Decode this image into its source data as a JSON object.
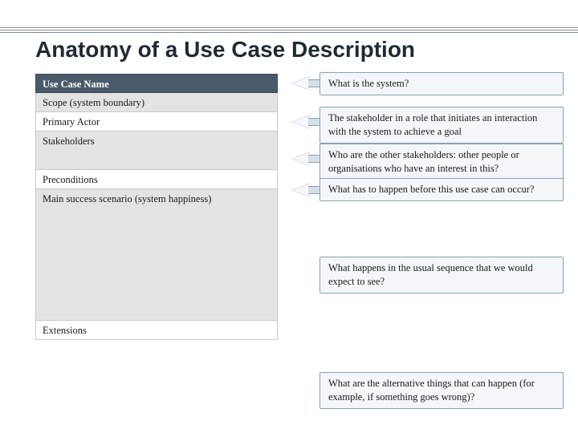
{
  "title": "Anatomy of a Use Case Description",
  "rows": {
    "use_case_name": "Use Case Name",
    "scope": "Scope (system boundary)",
    "primary_actor": "Primary Actor",
    "stakeholders": "Stakeholders",
    "preconditions": "Preconditions",
    "main_success": "Main success scenario (system happiness)",
    "extensions": "Extensions"
  },
  "callouts": {
    "system": "What is the system?",
    "stakeholder_role": "The stakeholder in a role that initiates an interaction with the system to achieve a goal",
    "other_stakeholders": "Who are the other stakeholders: other people or organisations who have an interest in this?",
    "preconditions": "What has to happen before this use case can occur?",
    "usual_sequence": "What happens in the usual sequence that we would expect to see?",
    "alternatives": "What are the alternative things that can happen (for example, if something goes wrong)?"
  }
}
